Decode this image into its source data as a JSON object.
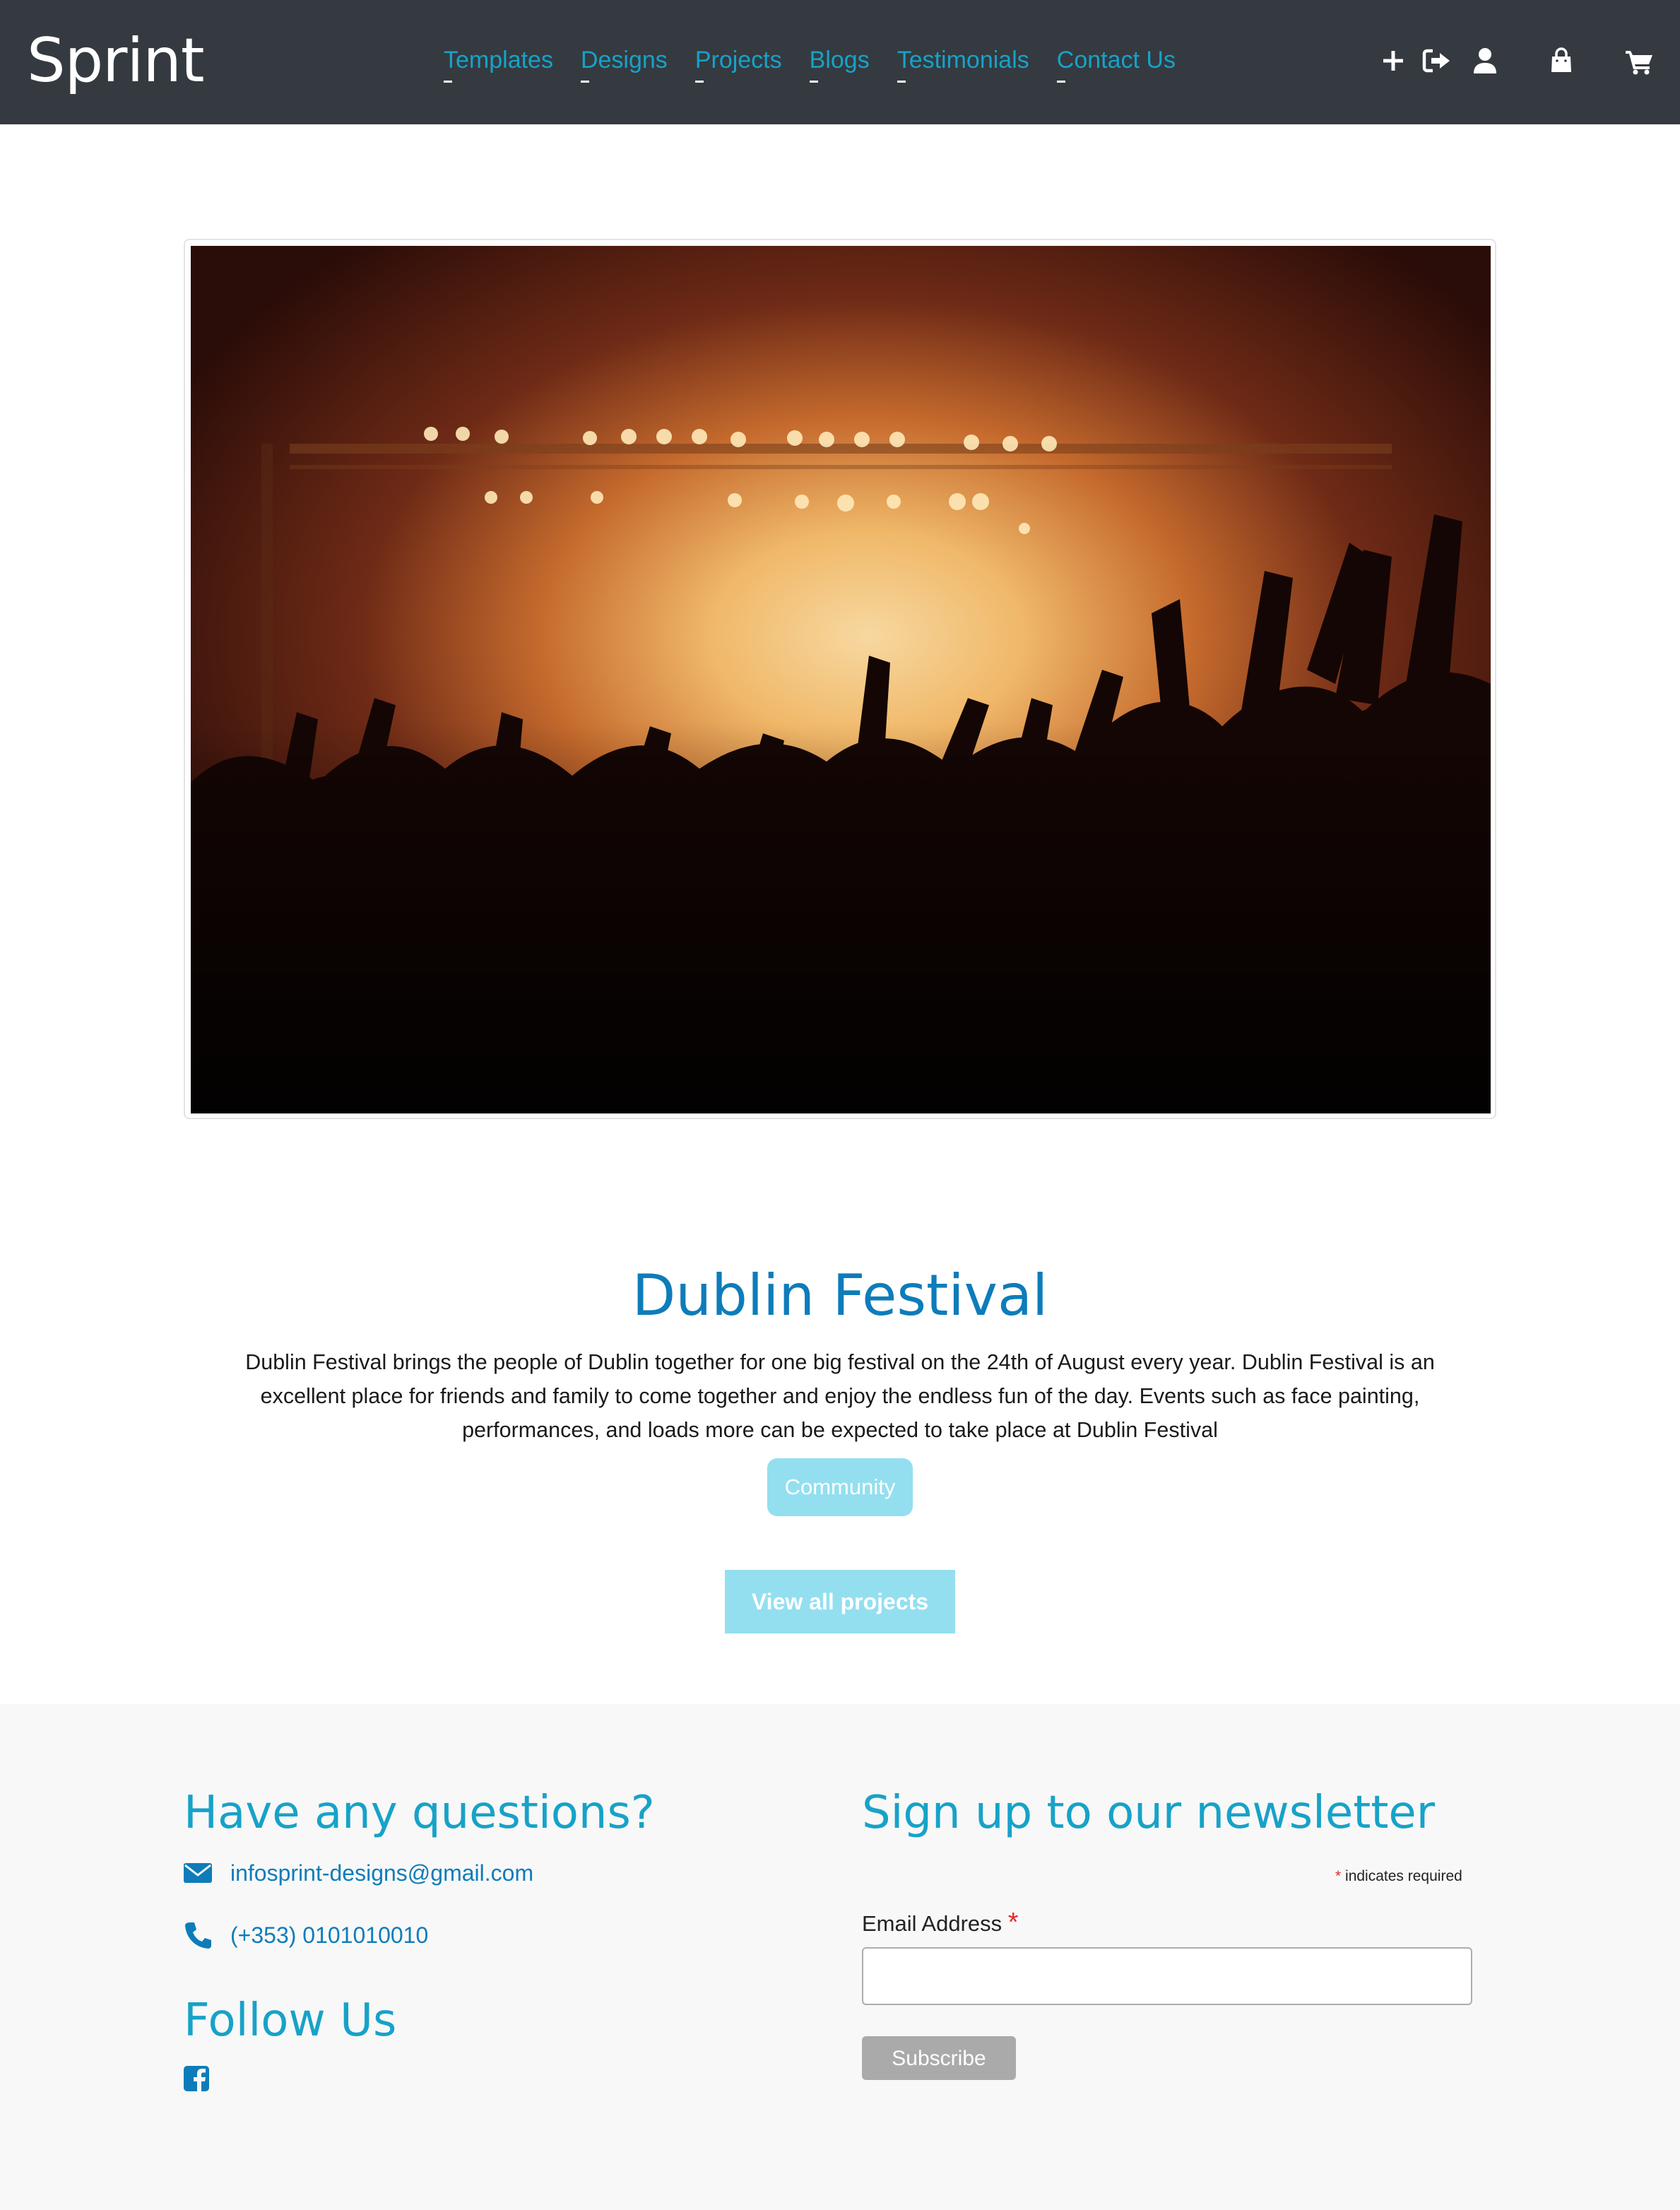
{
  "brand": "Sprint",
  "nav": {
    "links": [
      "Templates",
      "Designs",
      "Projects",
      "Blogs",
      "Testimonials",
      "Contact Us"
    ],
    "icons": [
      "plus-icon",
      "sign-out-icon",
      "user-icon",
      "shopping-bag-icon",
      "shopping-cart-icon"
    ]
  },
  "project": {
    "title": "Dublin Festival",
    "description": "Dublin Festival brings the people of Dublin together for one big festival on the 24th of August every year. Dublin Festival is an excellent place for friends and family to come together and enjoy the endless fun of the day. Events such as face painting, performances, and loads more can be expected to take place at Dublin Festival",
    "tag": "Community",
    "view_all_label": "View all projects"
  },
  "footer": {
    "questions_heading": "Have any questions?",
    "email": "infosprint-designs@gmail.com",
    "phone": "(+353) 0101010010",
    "follow_heading": "Follow Us",
    "newsletter_heading": "Sign up to our newsletter",
    "required_star": "*",
    "required_note": "indicates required",
    "email_label": "Email Address",
    "email_value": "",
    "subscribe_label": "Subscribe"
  },
  "colors": {
    "navbar_bg": "#343a40",
    "link": "#17a2c8",
    "title": "#0e7cba",
    "button_light": "#93dff0",
    "footer_bg": "#f8f8f8",
    "required": "#e02b2b"
  }
}
